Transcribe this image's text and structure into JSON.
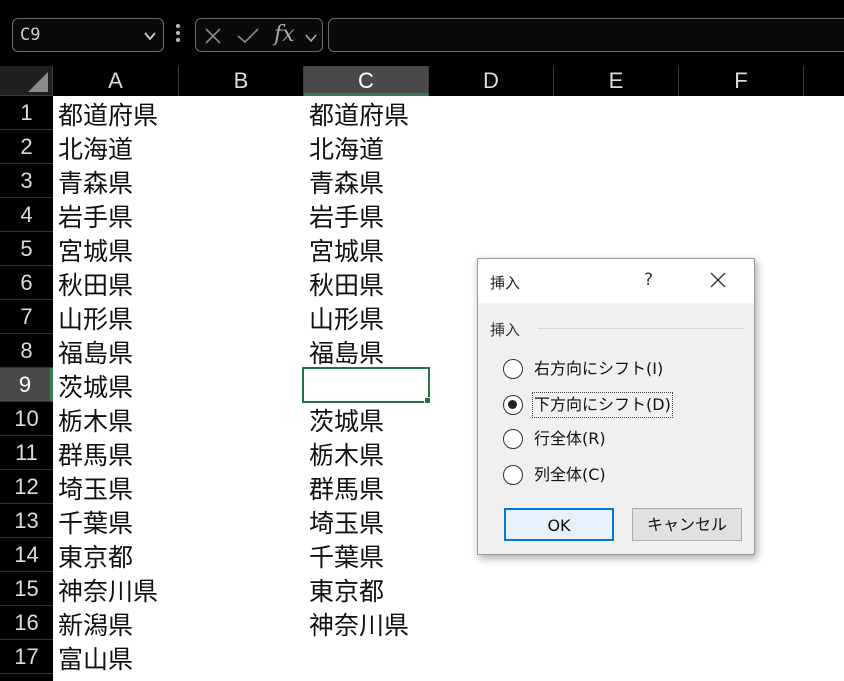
{
  "namebox": {
    "value": "C9"
  },
  "formula_bar": {
    "fx_label": "fx",
    "content": ""
  },
  "columns": [
    "A",
    "B",
    "C",
    "D",
    "E",
    "F"
  ],
  "selected_column": "C",
  "rows": [
    "1",
    "2",
    "3",
    "4",
    "5",
    "6",
    "7",
    "8",
    "9",
    "10",
    "11",
    "12",
    "13",
    "14",
    "15",
    "16",
    "17"
  ],
  "selected_row": "9",
  "column_a": [
    "都道府県",
    "北海道",
    "青森県",
    "岩手県",
    "宮城県",
    "秋田県",
    "山形県",
    "福島県",
    "茨城県",
    "栃木県",
    "群馬県",
    "埼玉県",
    "千葉県",
    "東京都",
    "神奈川県",
    "新潟県",
    "富山県"
  ],
  "column_c": [
    "都道府県",
    "北海道",
    "青森県",
    "岩手県",
    "宮城県",
    "秋田県",
    "山形県",
    "福島県",
    "",
    "茨城県",
    "栃木県",
    "群馬県",
    "埼玉県",
    "千葉県",
    "東京都",
    "神奈川県",
    ""
  ],
  "dialog": {
    "title": "挿入",
    "help": "?",
    "group_label": "挿入",
    "options": [
      {
        "label": "右方向にシフト(I)",
        "selected": false
      },
      {
        "label": "下方向にシフト(D)",
        "selected": true
      },
      {
        "label": "行全体(R)",
        "selected": false
      },
      {
        "label": "列全体(C)",
        "selected": false
      }
    ],
    "ok_label": "OK",
    "cancel_label": "キャンセル"
  },
  "colors": {
    "selection_green": "#217346",
    "header_selected": "#4a4a4a",
    "ok_border": "#0078d4"
  }
}
